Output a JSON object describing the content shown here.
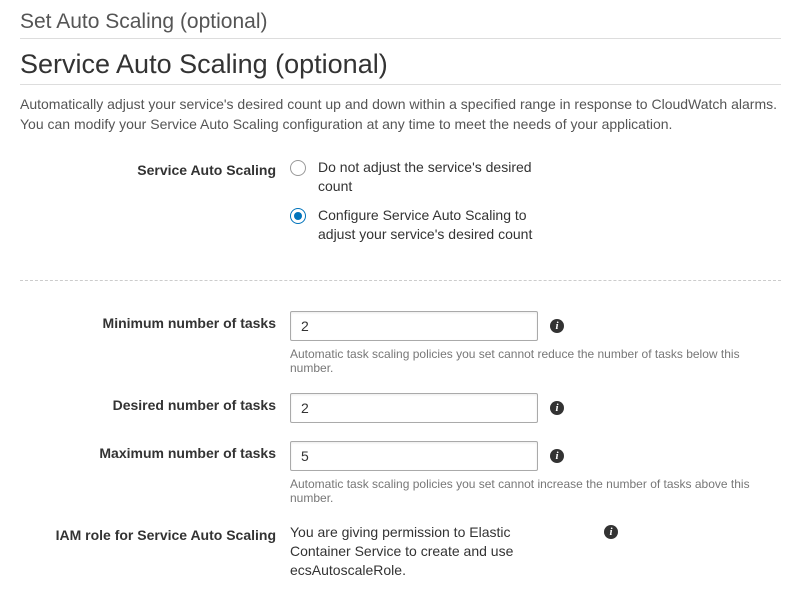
{
  "page": {
    "set_title": "Set Auto Scaling (optional)",
    "section_title": "Service Auto Scaling (optional)",
    "description": "Automatically adjust your service's desired count up and down within a specified range in response to CloudWatch alarms. You can modify your Service Auto Scaling configuration at any time to meet the needs of your application."
  },
  "radio": {
    "label": "Service Auto Scaling",
    "option_no_adjust": "Do not adjust the service's desired count",
    "option_configure": "Configure Service Auto Scaling to adjust your service's desired count"
  },
  "min_tasks": {
    "label": "Minimum number of tasks",
    "value": "2",
    "help": "Automatic task scaling policies you set cannot reduce the number of tasks below this number."
  },
  "desired_tasks": {
    "label": "Desired number of tasks",
    "value": "2"
  },
  "max_tasks": {
    "label": "Maximum number of tasks",
    "value": "5",
    "help": "Automatic task scaling policies you set cannot increase the number of tasks above this number."
  },
  "iam_role": {
    "label": "IAM role for Service Auto Scaling",
    "text_before": "You are giving permission to Elastic Container Service to create and use ",
    "role_name": "ecsAutoscaleRole",
    "text_after": "."
  }
}
